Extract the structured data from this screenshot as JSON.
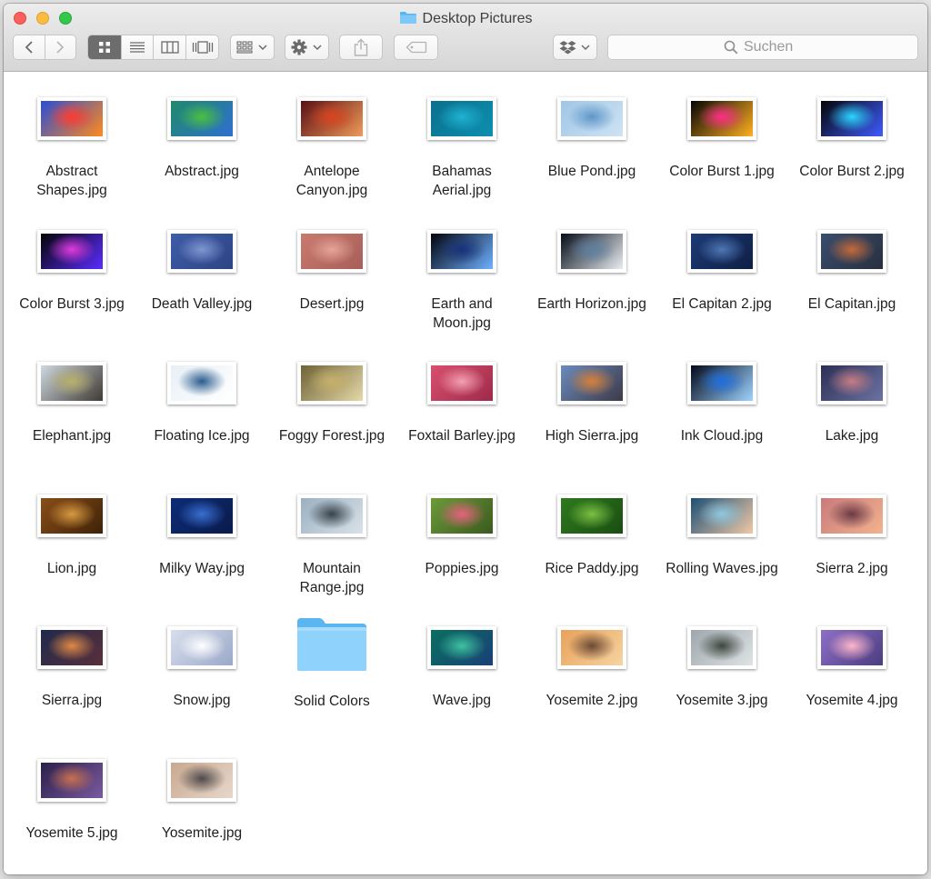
{
  "window": {
    "title": "Desktop Pictures",
    "folder_icon": "blue-folder-icon"
  },
  "toolbar": {
    "back_icon": "chevron-left-icon",
    "forward_icon": "chevron-right-icon",
    "view_modes": [
      "icon-view-icon",
      "list-view-icon",
      "column-view-icon",
      "coverflow-view-icon"
    ],
    "active_view": "icon-view-icon",
    "arrange_icon": "arrange-grid-icon",
    "action_icon": "gear-icon",
    "share_icon": "share-icon",
    "tag_icon": "tag-icon",
    "dropbox_icon": "dropbox-icon",
    "search_placeholder": "Suchen",
    "search_icon": "magnifier-icon"
  },
  "colors": {
    "accent": "#6d6d6d",
    "folder": "#5ab5f0",
    "close": "#fc605c",
    "minimize": "#fdbc40",
    "maximize": "#34c84a"
  },
  "items": [
    {
      "name": "Abstract\nShapes.jpg",
      "kind": "image",
      "colors": [
        "#2a4ed6",
        "#ff3b2f",
        "#ff8a1c"
      ]
    },
    {
      "name": "Abstract.jpg",
      "kind": "image",
      "colors": [
        "#1f8a6a",
        "#4bbf3f",
        "#2f6fd0"
      ]
    },
    {
      "name": "Antelope\nCanyon.jpg",
      "kind": "image",
      "colors": [
        "#5a0f12",
        "#d9441f",
        "#f09a5a"
      ]
    },
    {
      "name": "Bahamas\nAerial.jpg",
      "kind": "image",
      "colors": [
        "#0b6f8c",
        "#1fb2d1",
        "#0d8fb0"
      ]
    },
    {
      "name": "Blue Pond.jpg",
      "kind": "image",
      "colors": [
        "#9fc6e6",
        "#5f97c8",
        "#cfe3f3"
      ]
    },
    {
      "name": "Color Burst 1.jpg",
      "kind": "image",
      "colors": [
        "#050505",
        "#ff2d8a",
        "#ffb020"
      ]
    },
    {
      "name": "Color Burst 2.jpg",
      "kind": "image",
      "colors": [
        "#050505",
        "#2bd6ff",
        "#3e5bff"
      ]
    },
    {
      "name": "Color Burst 3.jpg",
      "kind": "image",
      "colors": [
        "#050505",
        "#e03bdc",
        "#5b2cff"
      ]
    },
    {
      "name": "Death Valley.jpg",
      "kind": "image",
      "colors": [
        "#3e5da8",
        "#7f97d1",
        "#2d4483"
      ]
    },
    {
      "name": "Desert.jpg",
      "kind": "image",
      "colors": [
        "#c97a6d",
        "#e6a596",
        "#a75f59"
      ]
    },
    {
      "name": "Earth and\nMoon.jpg",
      "kind": "image",
      "colors": [
        "#01030c",
        "#18307a",
        "#6fb1ff"
      ]
    },
    {
      "name": "Earth Horizon.jpg",
      "kind": "image",
      "colors": [
        "#050b18",
        "#5c7fa0",
        "#e9eef2"
      ]
    },
    {
      "name": "El Capitan 2.jpg",
      "kind": "image",
      "colors": [
        "#1e3b75",
        "#4f76b5",
        "#0e1f44"
      ]
    },
    {
      "name": "El Capitan.jpg",
      "kind": "image",
      "colors": [
        "#3a4d6e",
        "#c46a3a",
        "#27303f"
      ]
    },
    {
      "name": "Elephant.jpg",
      "kind": "image",
      "colors": [
        "#cfd9e0",
        "#b9b06c",
        "#3f3a34"
      ]
    },
    {
      "name": "Floating Ice.jpg",
      "kind": "image",
      "colors": [
        "#e7f0f6",
        "#2a5b8e",
        "#ffffff"
      ]
    },
    {
      "name": "Foggy Forest.jpg",
      "kind": "image",
      "colors": [
        "#6e6236",
        "#c7b06a",
        "#e5d9a8"
      ]
    },
    {
      "name": "Foxtail Barley.jpg",
      "kind": "image",
      "colors": [
        "#d9506e",
        "#f3a0b2",
        "#9e2a4a"
      ]
    },
    {
      "name": "High Sierra.jpg",
      "kind": "image",
      "colors": [
        "#6b8bbd",
        "#d7813a",
        "#3d3a48"
      ]
    },
    {
      "name": "Ink Cloud.jpg",
      "kind": "image",
      "colors": [
        "#02081a",
        "#1f6fe0",
        "#9fd4ff"
      ]
    },
    {
      "name": "Lake.jpg",
      "kind": "image",
      "colors": [
        "#2c2f54",
        "#c77c85",
        "#6b73a3"
      ]
    },
    {
      "name": "Lion.jpg",
      "kind": "image",
      "colors": [
        "#8a4e17",
        "#d79a41",
        "#3e2209"
      ]
    },
    {
      "name": "Milky Way.jpg",
      "kind": "image",
      "colors": [
        "#0d2c77",
        "#3a6ed1",
        "#0a1b4a"
      ]
    },
    {
      "name": "Mountain\nRange.jpg",
      "kind": "image",
      "colors": [
        "#9ab0c2",
        "#37424a",
        "#d9e2e8"
      ]
    },
    {
      "name": "Poppies.jpg",
      "kind": "image",
      "colors": [
        "#6b9a3a",
        "#e8607e",
        "#3b5a1e"
      ]
    },
    {
      "name": "Rice Paddy.jpg",
      "kind": "image",
      "colors": [
        "#2e7a1e",
        "#7bc043",
        "#1b4d12"
      ]
    },
    {
      "name": "Rolling Waves.jpg",
      "kind": "image",
      "colors": [
        "#1d4f74",
        "#8fc7de",
        "#f0c9a6"
      ]
    },
    {
      "name": "Sierra 2.jpg",
      "kind": "image",
      "colors": [
        "#c97a7c",
        "#6b3a45",
        "#f2b38e"
      ]
    },
    {
      "name": "Sierra.jpg",
      "kind": "image",
      "colors": [
        "#1f2a4d",
        "#e08a45",
        "#5a2f3a"
      ]
    },
    {
      "name": "Snow.jpg",
      "kind": "image",
      "colors": [
        "#d8deec",
        "#ffffff",
        "#9aa8c9"
      ]
    },
    {
      "name": "Solid Colors",
      "kind": "folder"
    },
    {
      "name": "Wave.jpg",
      "kind": "image",
      "colors": [
        "#0a6f5f",
        "#3fc2a0",
        "#1a3f78"
      ]
    },
    {
      "name": "Yosemite 2.jpg",
      "kind": "image",
      "colors": [
        "#e8a15a",
        "#6b4a34",
        "#f6d4a2"
      ]
    },
    {
      "name": "Yosemite 3.jpg",
      "kind": "image",
      "colors": [
        "#9ea7ad",
        "#3d4840",
        "#dfe3e4"
      ]
    },
    {
      "name": "Yosemite 4.jpg",
      "kind": "image",
      "colors": [
        "#8e6fc8",
        "#ffb6c7",
        "#4b3d7e"
      ]
    },
    {
      "name": "Yosemite 5.jpg",
      "kind": "image",
      "colors": [
        "#2a1f4a",
        "#c86f4f",
        "#7a5aa0"
      ]
    },
    {
      "name": "Yosemite.jpg",
      "kind": "image",
      "colors": [
        "#c9a88f",
        "#4f4a4c",
        "#e7d8cb"
      ]
    }
  ]
}
